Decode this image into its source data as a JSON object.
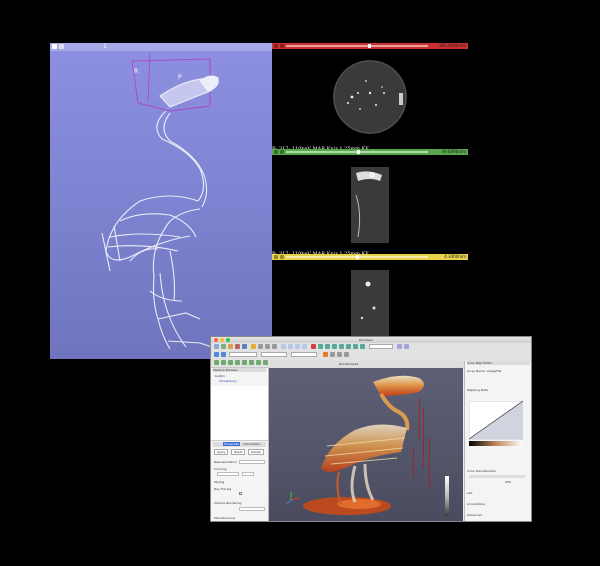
{
  "slicer": {
    "view3d": {
      "header_label": "1",
      "orientation_labels": {
        "right": "R",
        "posterior": "P"
      }
    },
    "slice_views": [
      {
        "name": "red",
        "color": "#c93030",
        "value": "-385.0000mm",
        "slider_fraction": 0.55,
        "label": ""
      },
      {
        "name": "green",
        "color": "#57a84a",
        "value": "49.8896mm",
        "slider_fraction": 0.5,
        "label": "B: 317: 110keV MAR Kniz 1.25mm KF"
      },
      {
        "name": "yellow",
        "color": "#e6d24a",
        "value": "4.3400mm",
        "slider_fraction": 0.5,
        "label": "B: 317: 110keV MAR Kniz 1.25mm KF"
      }
    ]
  },
  "paraview": {
    "title": "ParaView",
    "window_controls": {
      "close": "#ff5f57",
      "minimize": "#febc2e",
      "zoom": "#28c840"
    },
    "pipeline": {
      "header": "Pipeline Browser",
      "items": [
        "builtin:",
        "Shrewsbury"
      ]
    },
    "properties_tabs": [
      "Properties",
      "Information"
    ],
    "properties_buttons": [
      "Apply",
      "Reset",
      "Delete"
    ],
    "sections": [
      "Representation",
      "Coloring",
      "Styling",
      "Ray Tracing",
      "Volume Rendering",
      "Miscellaneous",
      "Show Mesh Visibility"
    ],
    "render_view_tab": "RenderView1",
    "color_map_editor": {
      "header": "Color Map Editor",
      "array_name": "Array Name: ImageFile",
      "mapping_data": "Mapping Data",
      "color_discretization": "Color Discretization",
      "annotations": "Annotations",
      "color_space": "Lab",
      "number_of_table_values": "256",
      "advanced": "Advanced"
    },
    "colors": {
      "volume_fire": "#e0561e",
      "volume_light": "#efe3cf",
      "accent": "#3f6fd6"
    }
  }
}
